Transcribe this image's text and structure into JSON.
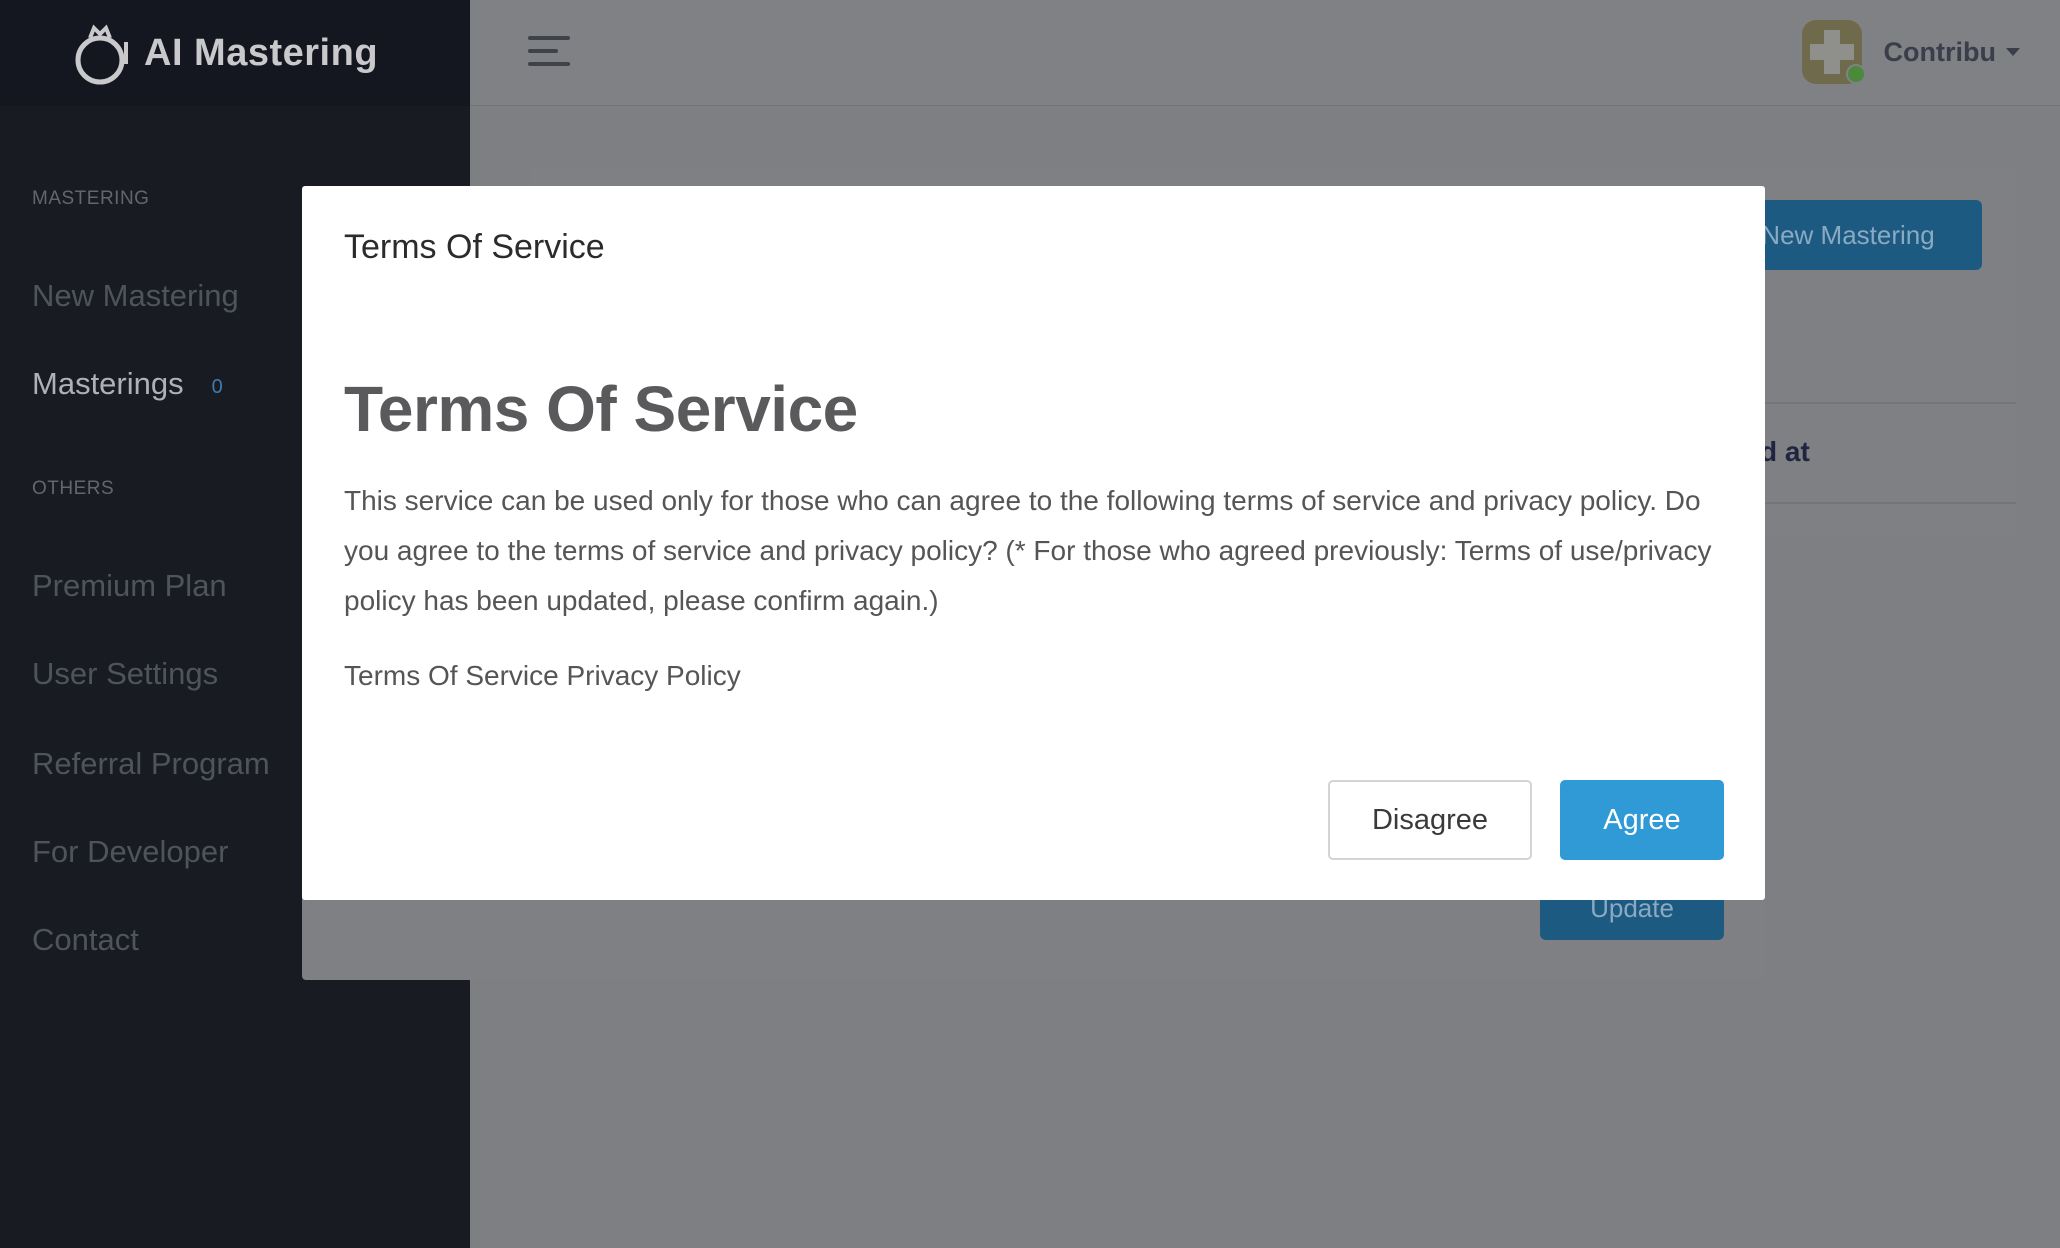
{
  "app": {
    "brand_name": "AI Mastering"
  },
  "sidebar": {
    "sections": [
      {
        "label": "MASTERING"
      },
      {
        "label": "OTHERS"
      }
    ],
    "items": [
      {
        "label": "New Mastering"
      },
      {
        "label": "Masterings",
        "count": "0"
      },
      {
        "label": "Premium Plan"
      },
      {
        "label": "User Settings"
      },
      {
        "label": "Referral Program"
      },
      {
        "label": "For Developer"
      },
      {
        "label": "Contact"
      }
    ]
  },
  "header": {
    "user_name": "Contribu"
  },
  "background": {
    "new_mastering_button": "New Mastering",
    "column_header_fragment": "d at",
    "update_button": "Update"
  },
  "modal": {
    "title": "Terms Of Service",
    "heading": "Terms Of Service",
    "body": "This service can be used only for those who can agree to the following terms of service and privacy policy. Do you agree to the terms of service and privacy policy? (* For those who agreed previously: Terms of use/privacy policy has been updated, please confirm again.)",
    "link_terms": "Terms Of Service",
    "link_privacy": "Privacy Policy",
    "disagree_button": "Disagree",
    "agree_button": "Agree"
  },
  "colors": {
    "accent": "#2f9ad6",
    "sidebar_bg": "#181b22",
    "overlay": "#7d7f82"
  }
}
